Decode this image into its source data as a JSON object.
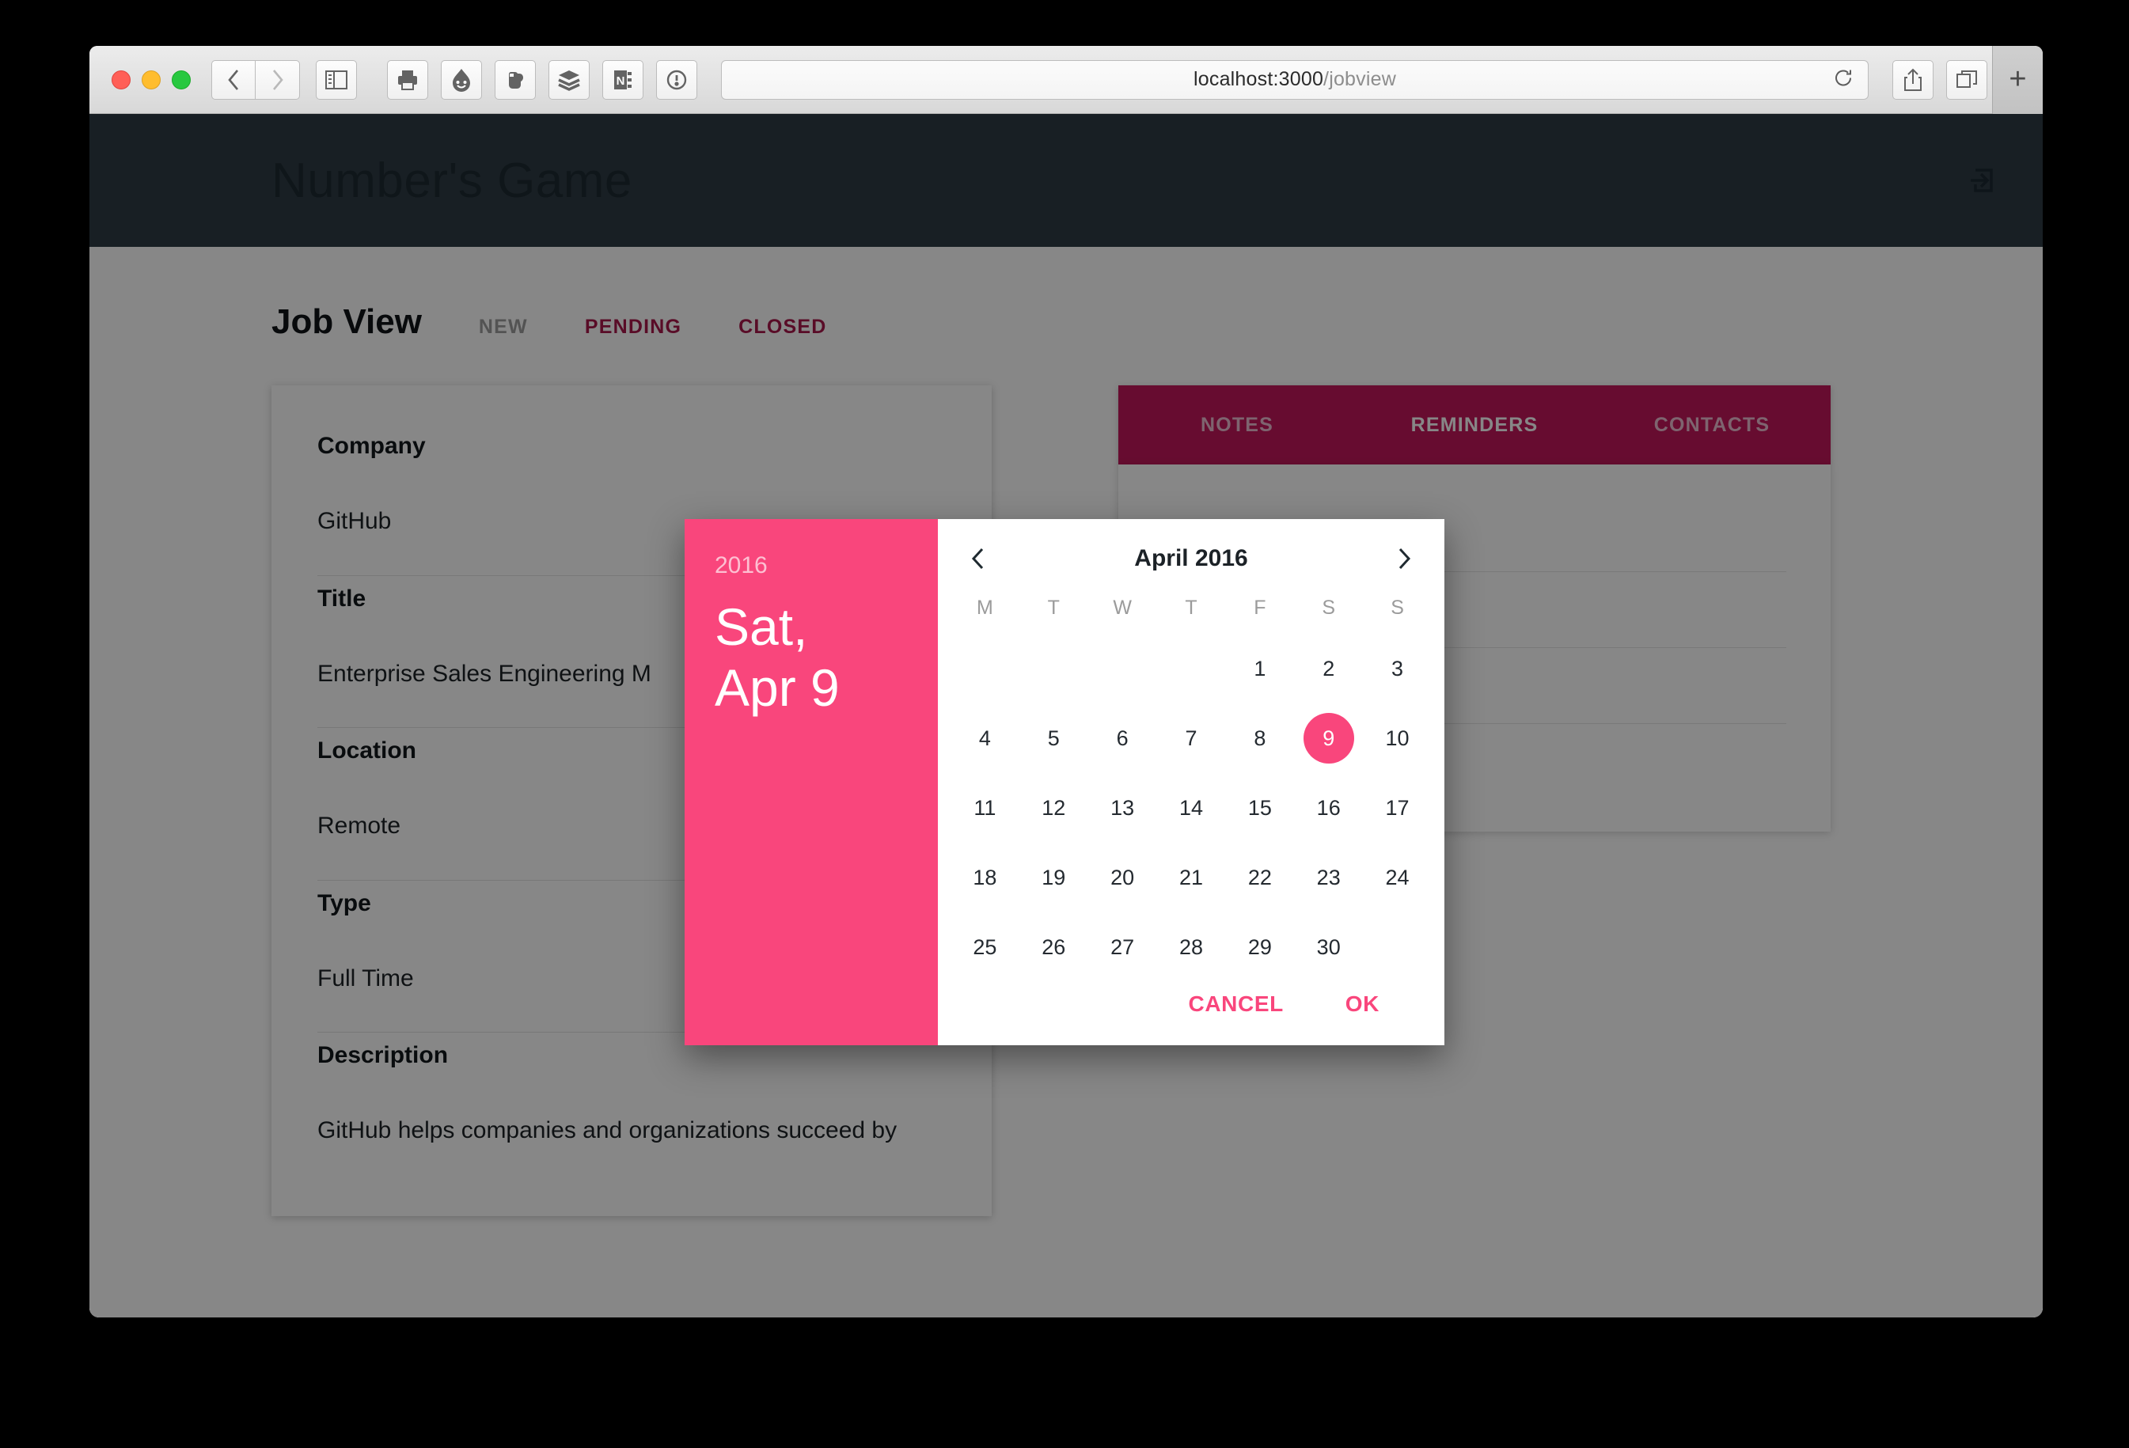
{
  "browser": {
    "url_host": "localhost:3000",
    "url_path": "/jobview",
    "toolbar_icons": [
      "print-icon",
      "pocket-icon",
      "evernote-icon",
      "buffer-icon",
      "onenote-icon",
      "onepassword-icon"
    ],
    "back_label": "‹",
    "forward_label": "›",
    "new_tab_label": "+"
  },
  "app": {
    "title": "Number's Game",
    "logout_icon": "logout-icon"
  },
  "main": {
    "page_title": "Job View",
    "status_tabs": [
      {
        "label": "NEW",
        "active": false
      },
      {
        "label": "PENDING",
        "active": true
      },
      {
        "label": "CLOSED",
        "active": true
      }
    ],
    "job": {
      "fields": [
        {
          "label": "Company",
          "value": "GitHub"
        },
        {
          "label": "Title",
          "value": "Enterprise Sales Engineering M"
        },
        {
          "label": "Location",
          "value": "Remote"
        },
        {
          "label": "Type",
          "value": "Full Time"
        },
        {
          "label": "Description",
          "value": "GitHub helps companies and organizations succeed by"
        }
      ]
    },
    "side_tabs": [
      {
        "label": "NOTES",
        "active": false
      },
      {
        "label": "REMINDERS",
        "active": true
      },
      {
        "label": "CONTACTS",
        "active": false
      }
    ]
  },
  "datepicker": {
    "year": "2016",
    "selected_date_label": "Sat,\nApr 9",
    "month_title": "April 2016",
    "prev_icon": "chevron-left-icon",
    "next_icon": "chevron-right-icon",
    "weekdays": [
      "M",
      "T",
      "W",
      "T",
      "F",
      "S",
      "S"
    ],
    "weeks": [
      [
        "",
        "",
        "",
        "",
        "1",
        "2",
        "3"
      ],
      [
        "4",
        "5",
        "6",
        "7",
        "8",
        "9",
        "10"
      ],
      [
        "11",
        "12",
        "13",
        "14",
        "15",
        "16",
        "17"
      ],
      [
        "18",
        "19",
        "20",
        "21",
        "22",
        "23",
        "24"
      ],
      [
        "25",
        "26",
        "27",
        "28",
        "29",
        "30",
        ""
      ]
    ],
    "selected_day": "9",
    "cancel_label": "CANCEL",
    "ok_label": "OK"
  },
  "colors": {
    "accent_pink": "#f9467c",
    "header_dark": "#2f3c44",
    "tab_crimson": "#c2185b"
  }
}
